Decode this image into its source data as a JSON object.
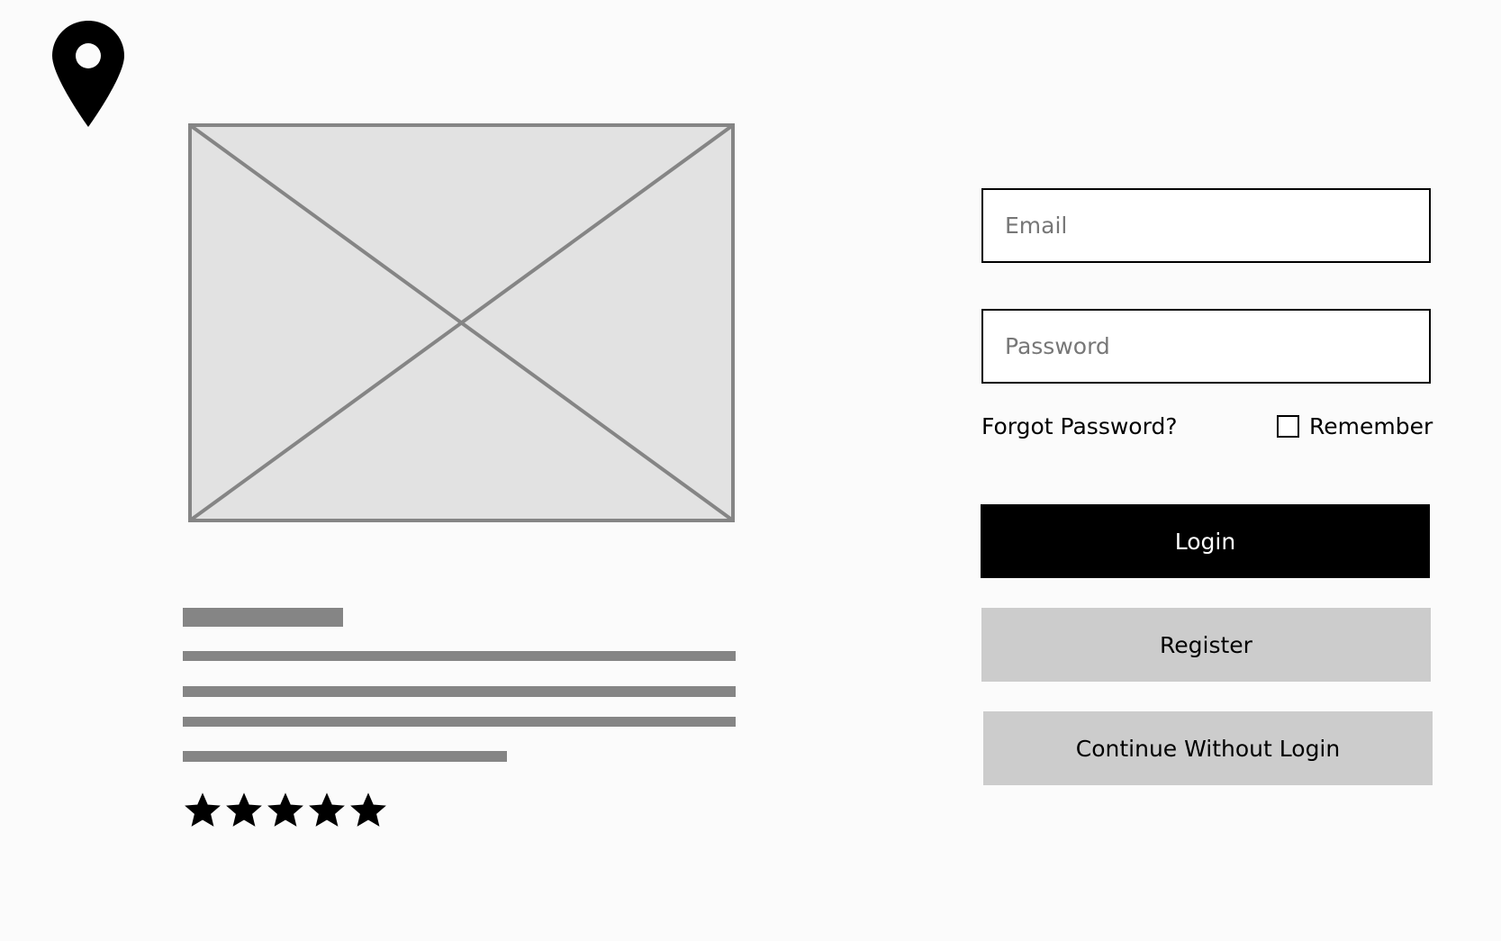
{
  "icons": {
    "logo": "map-pin-icon",
    "image": "image-placeholder-icon",
    "rating": "star-icon"
  },
  "card": {
    "rating_stars": 5,
    "rating_max": 5
  },
  "login_form": {
    "email_placeholder": "Email",
    "password_placeholder": "Password",
    "forgot_password": "Forgot Password?",
    "remember_label": "Remember",
    "remember_checked": false,
    "login_label": "Login",
    "register_label": "Register",
    "continue_label": "Continue Without Login"
  },
  "colors": {
    "primary": "#000000",
    "secondary": "#cccccc",
    "placeholder_fill": "#e2e2e2",
    "placeholder_stroke": "#858585",
    "background": "#fbfbfb"
  }
}
